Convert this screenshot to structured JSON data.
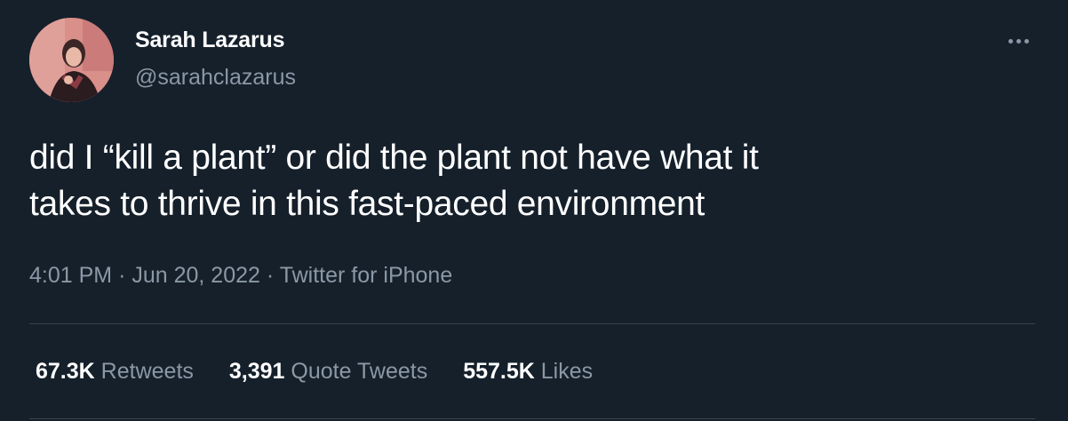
{
  "user": {
    "name": "Sarah Lazarus",
    "handle": "@sarahclazarus"
  },
  "tweet": {
    "text_line1": "did I “kill a plant” or did the plant not have what it",
    "text_line2": "takes to thrive in this fast-paced environment",
    "time": "4:01 PM",
    "date": "Jun 20, 2022",
    "source": "Twitter for iPhone",
    "separator": "·"
  },
  "stats": [
    {
      "count": "67.3K",
      "label": "Retweets"
    },
    {
      "count": "3,391",
      "label": "Quote Tweets"
    },
    {
      "count": "557.5K",
      "label": "Likes"
    }
  ],
  "icons": {
    "more": "more-horizontal-icon"
  },
  "colors": {
    "background": "#15202b",
    "primary_text": "#ffffff",
    "secondary_text": "#8b98a5",
    "divider": "#38444d"
  }
}
